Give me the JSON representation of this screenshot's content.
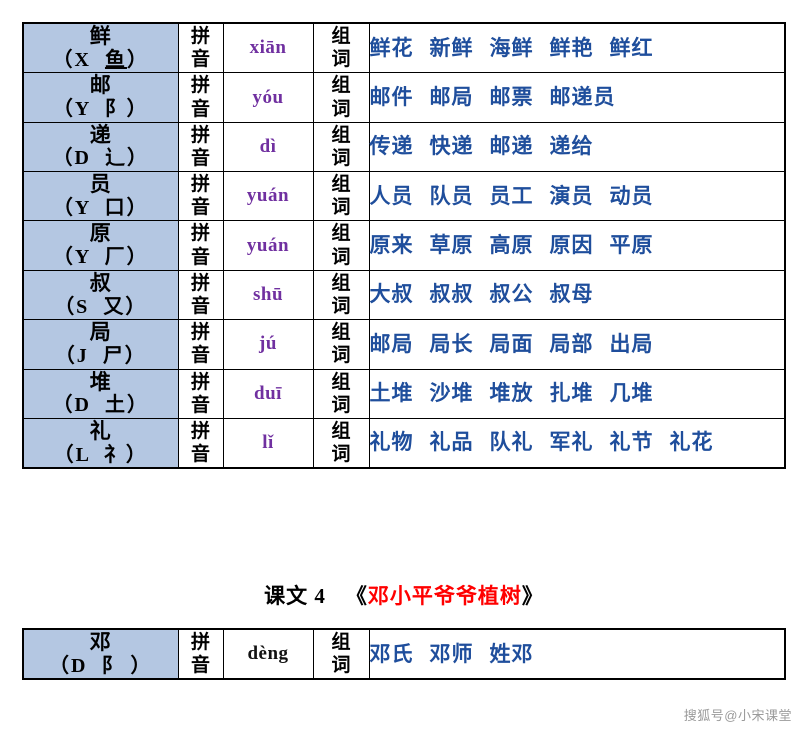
{
  "document": {
    "labels": {
      "pinyin_label_chars": [
        "拼",
        "音"
      ],
      "words_label_chars": [
        "组",
        "词"
      ]
    },
    "tables": [
      {
        "id": "lesson3-vocab-table",
        "rows": [
          {
            "character": "鲜",
            "radical_prefix": "（X",
            "radical_component": "鱼",
            "radical_component_underlined": true,
            "radical_suffix": "）",
            "pinyin": "xiān",
            "pinyin_color": "purple",
            "words": [
              "鲜花",
              "新鲜",
              "海鲜",
              "鲜艳",
              "鲜红"
            ]
          },
          {
            "character": "邮",
            "radical_prefix": "（Y",
            "radical_component": "阝",
            "radical_component_underlined": false,
            "radical_suffix": "）",
            "pinyin": "yóu",
            "pinyin_color": "purple",
            "words": [
              "邮件",
              "邮局",
              "邮票",
              "邮递员"
            ]
          },
          {
            "character": "递",
            "radical_prefix": "（D",
            "radical_component": "辶",
            "radical_component_underlined": false,
            "radical_suffix": "）",
            "pinyin": "dì",
            "pinyin_color": "purple",
            "words": [
              "传递",
              "快递",
              "邮递",
              "递给"
            ]
          },
          {
            "character": "员",
            "radical_prefix": "（Y",
            "radical_component": "口",
            "radical_component_underlined": false,
            "radical_suffix": "）",
            "pinyin": "yuán",
            "pinyin_color": "purple",
            "words": [
              "人员",
              "队员",
              "员工",
              "演员",
              "动员"
            ]
          },
          {
            "character": "原",
            "radical_prefix": "（Y",
            "radical_component": "厂",
            "radical_component_underlined": false,
            "radical_suffix": "）",
            "pinyin": "yuán",
            "pinyin_color": "purple",
            "words": [
              "原来",
              "草原",
              "高原",
              "原因",
              "平原"
            ]
          },
          {
            "character": "叔",
            "radical_prefix": "（S",
            "radical_component": "又",
            "radical_component_underlined": false,
            "radical_suffix": "）",
            "pinyin": "shū",
            "pinyin_color": "purple",
            "words": [
              "大叔",
              "叔叔",
              "叔公",
              "叔母"
            ]
          },
          {
            "character": "局",
            "radical_prefix": "（J",
            "radical_component": "尸",
            "radical_component_underlined": false,
            "radical_suffix": "）",
            "pinyin": "jú",
            "pinyin_color": "purple",
            "words": [
              "邮局",
              "局长",
              "局面",
              "局部",
              "出局"
            ]
          },
          {
            "character": "堆",
            "radical_prefix": "（D",
            "radical_component": "土",
            "radical_component_underlined": false,
            "radical_suffix": "）",
            "pinyin": "duī",
            "pinyin_color": "purple",
            "words": [
              "土堆",
              "沙堆",
              "堆放",
              "扎堆",
              "几堆"
            ]
          },
          {
            "character": "礼",
            "radical_prefix": "（L",
            "radical_component": "礻",
            "radical_component_underlined": false,
            "radical_suffix": "）",
            "pinyin": "lǐ",
            "pinyin_color": "purple",
            "words": [
              "礼物",
              "礼品",
              "队礼",
              "军礼",
              "礼节",
              "礼花"
            ]
          }
        ]
      },
      {
        "id": "lesson4-vocab-table",
        "rows": [
          {
            "character": "邓",
            "radical_prefix": "（D",
            "radical_component": "阝",
            "radical_component_underlined": false,
            "radical_suffix": "）",
            "pinyin": "dèng",
            "pinyin_color": "black",
            "words": [
              "邓氏",
              "邓师",
              "姓邓"
            ]
          }
        ]
      }
    ],
    "section_heading": {
      "lesson_label": "课文 4",
      "open_bracket": "《",
      "title": "邓小平爷爷植树",
      "close_bracket": "》"
    },
    "watermark": "搜狐号@小宋课堂",
    "colors": {
      "cell_blue": "#b4c7e2",
      "word_blue": "#1f4e9c",
      "pinyin_purple": "#7030a0",
      "title_red": "#ff0000",
      "ink_black": "#000000"
    }
  }
}
